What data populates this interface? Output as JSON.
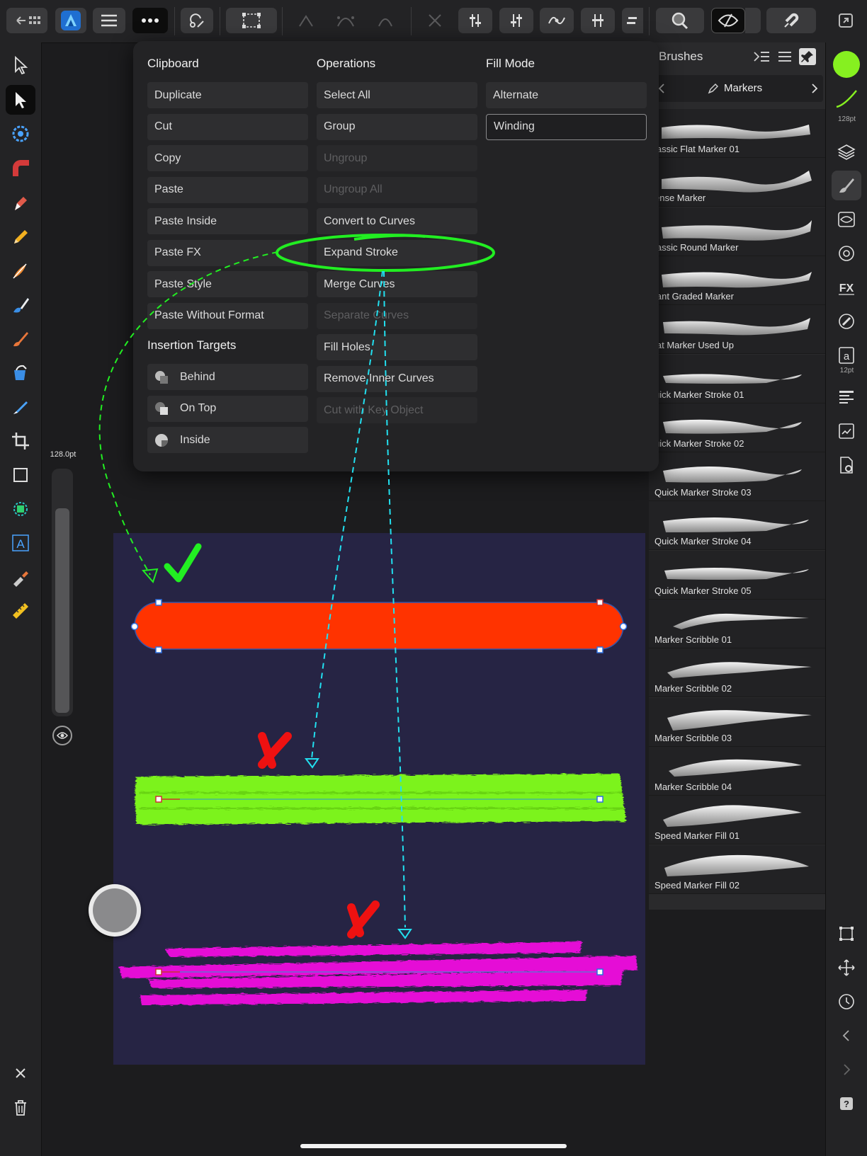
{
  "toolbar": {
    "back_icon": "back-grid-icon",
    "app_icon": "affinity-designer-icon",
    "buttons": [
      "hamburger-menu-icon",
      "more-icon",
      "snapping-icon",
      "transform-box-icon",
      "sharp-node-icon",
      "smooth-node-icon",
      "smart-node-icon",
      "break-curve-icon",
      "align-left-icon",
      "align-center-icon",
      "curve-icon",
      "align-right-icon",
      "distribute-icon",
      "zoom-icon",
      "view-mode-icon",
      "magnet-icon",
      "expand-icon"
    ]
  },
  "menu": {
    "clipboard": {
      "title": "Clipboard",
      "items": [
        "Duplicate",
        "Cut",
        "Copy",
        "Paste",
        "Paste Inside",
        "Paste FX",
        "Paste Style",
        "Paste Without Format"
      ]
    },
    "insertion": {
      "title": "Insertion Targets",
      "items": [
        "Behind",
        "On Top",
        "Inside"
      ]
    },
    "operations": {
      "title": "Operations",
      "items": [
        {
          "label": "Select All",
          "enabled": true
        },
        {
          "label": "Group",
          "enabled": true
        },
        {
          "label": "Ungroup",
          "enabled": false
        },
        {
          "label": "Ungroup All",
          "enabled": false
        },
        {
          "label": "Convert to Curves",
          "enabled": true
        },
        {
          "label": "Expand Stroke",
          "enabled": true
        },
        {
          "label": "Merge Curves",
          "enabled": true
        },
        {
          "label": "Separate Curves",
          "enabled": false
        },
        {
          "label": "Fill Holes",
          "enabled": true
        },
        {
          "label": "Remove Inner Curves",
          "enabled": true
        },
        {
          "label": "Cut with Key Object",
          "enabled": false
        }
      ]
    },
    "fillmode": {
      "title": "Fill Mode",
      "items": [
        "Alternate",
        "Winding"
      ],
      "selected": "Winding"
    }
  },
  "brushes": {
    "title": "Brushes",
    "category": "Markers",
    "items": [
      "lassic Flat Marker 01",
      "ense Marker",
      "lassic Round Marker",
      "lant Graded Marker",
      "lat Marker Used Up",
      "uick Marker Stroke 01",
      "uick Marker Stroke 02",
      "Quick Marker Stroke 03",
      "Quick Marker Stroke 04",
      "Quick Marker Stroke 05",
      "Marker Scribble 01",
      "Marker Scribble 02",
      "Marker Scribble 03",
      "Marker Scribble 04",
      "Speed Marker Fill 01",
      "Speed Marker Fill 02"
    ]
  },
  "left_tools": [
    "move-tool-icon",
    "node-tool-icon",
    "corner-tool-icon",
    "point-transform-tool-icon",
    "pen-tool-icon",
    "pencil-tool-icon",
    "vector-brush-tool-icon",
    "fill-tool-icon",
    "paint-brush-icon",
    "gradient-tool-icon",
    "transparency-tool-icon",
    "crop-tool-icon",
    "rectangle-tool-icon",
    "shape-tool-icon",
    "text-tool-icon",
    "color-picker-icon",
    "measure-tool-icon"
  ],
  "right_tools": {
    "stroke_label": "128pt",
    "text_label": "12pt",
    "stroke_color": "#86f020"
  },
  "size_slider": {
    "label": "128.0pt",
    "value_fraction": 0.85
  },
  "colors": {
    "orange_shape": "#ff3300",
    "green_stroke": "#7cf31b",
    "magenta_stroke": "#e510d6",
    "artboard": "#262444",
    "annotation_green": "#22ee22",
    "annotation_cyan": "#22e0f0",
    "annotation_red": "#ee1111"
  }
}
